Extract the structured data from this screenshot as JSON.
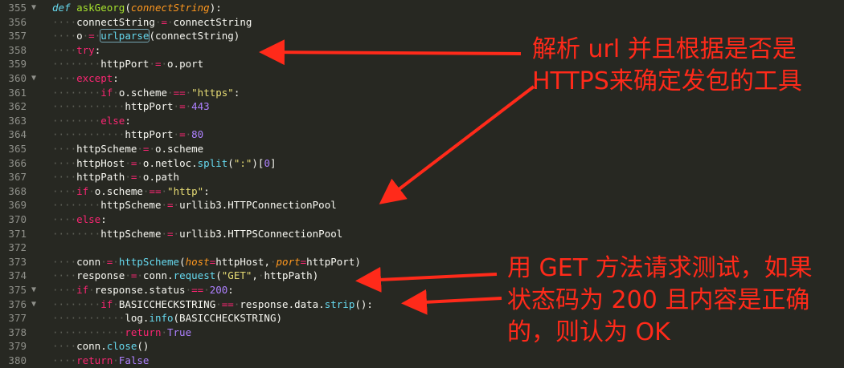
{
  "editor": {
    "lines": [
      {
        "num": "355",
        "fold": true,
        "tokens": [
          {
            "t": "def",
            "c": "kd"
          },
          {
            "t": " "
          },
          {
            "t": "askGeorg",
            "c": "fn"
          },
          {
            "t": "("
          },
          {
            "t": "connectString",
            "c": "a"
          },
          {
            "t": "):"
          }
        ]
      },
      {
        "num": "356",
        "tokens": [
          {
            "t": "····",
            "c": "w"
          },
          {
            "t": "connectString"
          },
          {
            "t": "·",
            "c": "w"
          },
          {
            "t": "=",
            "c": "k"
          },
          {
            "t": "·",
            "c": "w"
          },
          {
            "t": "connectString"
          }
        ]
      },
      {
        "num": "357",
        "tokens": [
          {
            "t": "····",
            "c": "w"
          },
          {
            "t": "o"
          },
          {
            "t": "·",
            "c": "w"
          },
          {
            "t": "=",
            "c": "k"
          },
          {
            "t": "·",
            "c": "w"
          },
          {
            "t": "urlparse",
            "c": "b box"
          },
          {
            "t": "(connectString)"
          }
        ]
      },
      {
        "num": "358",
        "tokens": [
          {
            "t": "····",
            "c": "w"
          },
          {
            "t": "try",
            "c": "k"
          },
          {
            "t": ":"
          }
        ]
      },
      {
        "num": "359",
        "tokens": [
          {
            "t": "········",
            "c": "w"
          },
          {
            "t": "httpPort"
          },
          {
            "t": "·",
            "c": "w"
          },
          {
            "t": "=",
            "c": "k"
          },
          {
            "t": "·",
            "c": "w"
          },
          {
            "t": "o.port"
          }
        ]
      },
      {
        "num": "360",
        "fold": true,
        "tokens": [
          {
            "t": "····",
            "c": "w"
          },
          {
            "t": "except",
            "c": "k"
          },
          {
            "t": ":"
          }
        ]
      },
      {
        "num": "361",
        "tokens": [
          {
            "t": "········",
            "c": "w"
          },
          {
            "t": "if",
            "c": "k"
          },
          {
            "t": "·",
            "c": "w"
          },
          {
            "t": "o.scheme"
          },
          {
            "t": "·",
            "c": "w"
          },
          {
            "t": "==",
            "c": "k"
          },
          {
            "t": "·",
            "c": "w"
          },
          {
            "t": "\"https\"",
            "c": "s"
          },
          {
            "t": ":"
          }
        ]
      },
      {
        "num": "362",
        "tokens": [
          {
            "t": "············",
            "c": "w"
          },
          {
            "t": "httpPort"
          },
          {
            "t": "·",
            "c": "w"
          },
          {
            "t": "=",
            "c": "k"
          },
          {
            "t": "·",
            "c": "w"
          },
          {
            "t": "443",
            "c": "n"
          }
        ]
      },
      {
        "num": "363",
        "tokens": [
          {
            "t": "········",
            "c": "w"
          },
          {
            "t": "else",
            "c": "k"
          },
          {
            "t": ":"
          }
        ]
      },
      {
        "num": "364",
        "tokens": [
          {
            "t": "············",
            "c": "w"
          },
          {
            "t": "httpPort"
          },
          {
            "t": "·",
            "c": "w"
          },
          {
            "t": "=",
            "c": "k"
          },
          {
            "t": "·",
            "c": "w"
          },
          {
            "t": "80",
            "c": "n"
          }
        ]
      },
      {
        "num": "365",
        "tokens": [
          {
            "t": "····",
            "c": "w"
          },
          {
            "t": "httpScheme"
          },
          {
            "t": "·",
            "c": "w"
          },
          {
            "t": "=",
            "c": "k"
          },
          {
            "t": "·",
            "c": "w"
          },
          {
            "t": "o.scheme"
          }
        ]
      },
      {
        "num": "366",
        "tokens": [
          {
            "t": "····",
            "c": "w"
          },
          {
            "t": "httpHost"
          },
          {
            "t": "·",
            "c": "w"
          },
          {
            "t": "=",
            "c": "k"
          },
          {
            "t": "·",
            "c": "w"
          },
          {
            "t": "o.netloc."
          },
          {
            "t": "split",
            "c": "b"
          },
          {
            "t": "("
          },
          {
            "t": "\":\"",
            "c": "s"
          },
          {
            "t": ")["
          },
          {
            "t": "0",
            "c": "n"
          },
          {
            "t": "]"
          }
        ]
      },
      {
        "num": "367",
        "tokens": [
          {
            "t": "····",
            "c": "w"
          },
          {
            "t": "httpPath"
          },
          {
            "t": "·",
            "c": "w"
          },
          {
            "t": "=",
            "c": "k"
          },
          {
            "t": "·",
            "c": "w"
          },
          {
            "t": "o.path"
          }
        ]
      },
      {
        "num": "368",
        "tokens": [
          {
            "t": "····",
            "c": "w"
          },
          {
            "t": "if",
            "c": "k"
          },
          {
            "t": "·",
            "c": "w"
          },
          {
            "t": "o.scheme"
          },
          {
            "t": "·",
            "c": "w"
          },
          {
            "t": "==",
            "c": "k"
          },
          {
            "t": "·",
            "c": "w"
          },
          {
            "t": "\"http\"",
            "c": "s"
          },
          {
            "t": ":"
          }
        ]
      },
      {
        "num": "369",
        "tokens": [
          {
            "t": "········",
            "c": "w"
          },
          {
            "t": "httpScheme"
          },
          {
            "t": "·",
            "c": "w"
          },
          {
            "t": "=",
            "c": "k"
          },
          {
            "t": "·",
            "c": "w"
          },
          {
            "t": "urllib3.HTTPConnectionPool"
          }
        ]
      },
      {
        "num": "370",
        "tokens": [
          {
            "t": "····",
            "c": "w"
          },
          {
            "t": "else",
            "c": "k"
          },
          {
            "t": ":"
          }
        ]
      },
      {
        "num": "371",
        "tokens": [
          {
            "t": "········",
            "c": "w"
          },
          {
            "t": "httpScheme"
          },
          {
            "t": "·",
            "c": "w"
          },
          {
            "t": "=",
            "c": "k"
          },
          {
            "t": "·",
            "c": "w"
          },
          {
            "t": "urllib3.HTTPSConnectionPool"
          }
        ]
      },
      {
        "num": "372",
        "tokens": []
      },
      {
        "num": "373",
        "tokens": [
          {
            "t": "····",
            "c": "w"
          },
          {
            "t": "conn"
          },
          {
            "t": "·",
            "c": "w"
          },
          {
            "t": "=",
            "c": "k"
          },
          {
            "t": "·",
            "c": "w"
          },
          {
            "t": "httpScheme",
            "c": "b"
          },
          {
            "t": "("
          },
          {
            "t": "host",
            "c": "a"
          },
          {
            "t": "=",
            "c": "k"
          },
          {
            "t": "httpHost,"
          },
          {
            "t": "·",
            "c": "w"
          },
          {
            "t": "port",
            "c": "a"
          },
          {
            "t": "=",
            "c": "k"
          },
          {
            "t": "httpPort)"
          }
        ]
      },
      {
        "num": "374",
        "tokens": [
          {
            "t": "····",
            "c": "w"
          },
          {
            "t": "response"
          },
          {
            "t": "·",
            "c": "w"
          },
          {
            "t": "=",
            "c": "k"
          },
          {
            "t": "·",
            "c": "w"
          },
          {
            "t": "conn."
          },
          {
            "t": "request",
            "c": "b"
          },
          {
            "t": "("
          },
          {
            "t": "\"GET\"",
            "c": "s"
          },
          {
            "t": ","
          },
          {
            "t": "·",
            "c": "w"
          },
          {
            "t": "httpPath)"
          }
        ]
      },
      {
        "num": "375",
        "fold": true,
        "tokens": [
          {
            "t": "····",
            "c": "w"
          },
          {
            "t": "if",
            "c": "k"
          },
          {
            "t": "·",
            "c": "w"
          },
          {
            "t": "response.status"
          },
          {
            "t": "·",
            "c": "w"
          },
          {
            "t": "==",
            "c": "k"
          },
          {
            "t": "·",
            "c": "w"
          },
          {
            "t": "200",
            "c": "n"
          },
          {
            "t": ":"
          }
        ]
      },
      {
        "num": "376",
        "fold": true,
        "tokens": [
          {
            "t": "········",
            "c": "w"
          },
          {
            "t": "if",
            "c": "k"
          },
          {
            "t": "·",
            "c": "w"
          },
          {
            "t": "BASICCHECKSTRING"
          },
          {
            "t": "·",
            "c": "w"
          },
          {
            "t": "==",
            "c": "k"
          },
          {
            "t": "·",
            "c": "w"
          },
          {
            "t": "response.data."
          },
          {
            "t": "strip",
            "c": "b"
          },
          {
            "t": "():"
          }
        ]
      },
      {
        "num": "377",
        "tokens": [
          {
            "t": "············",
            "c": "w"
          },
          {
            "t": "log."
          },
          {
            "t": "info",
            "c": "b"
          },
          {
            "t": "(BASICCHECKSTRING)"
          }
        ]
      },
      {
        "num": "378",
        "tokens": [
          {
            "t": "············",
            "c": "w"
          },
          {
            "t": "return",
            "c": "k"
          },
          {
            "t": "·",
            "c": "w"
          },
          {
            "t": "True",
            "c": "n"
          }
        ]
      },
      {
        "num": "379",
        "tokens": [
          {
            "t": "····",
            "c": "w"
          },
          {
            "t": "conn."
          },
          {
            "t": "close",
            "c": "b"
          },
          {
            "t": "()"
          }
        ]
      },
      {
        "num": "380",
        "tokens": [
          {
            "t": "····",
            "c": "w"
          },
          {
            "t": "return",
            "c": "k"
          },
          {
            "t": "·",
            "c": "w"
          },
          {
            "t": "False",
            "c": "n"
          }
        ]
      }
    ]
  },
  "annotations": {
    "note1": [
      "解析 url 并且根据是否是",
      "HTTPS来确定发包的工具"
    ],
    "note2": [
      "用 GET 方法请求测试，如果",
      "状态码为 200 且内容是正确",
      "的，则认为 OK"
    ],
    "arrow_color": "#ff2a1a"
  }
}
